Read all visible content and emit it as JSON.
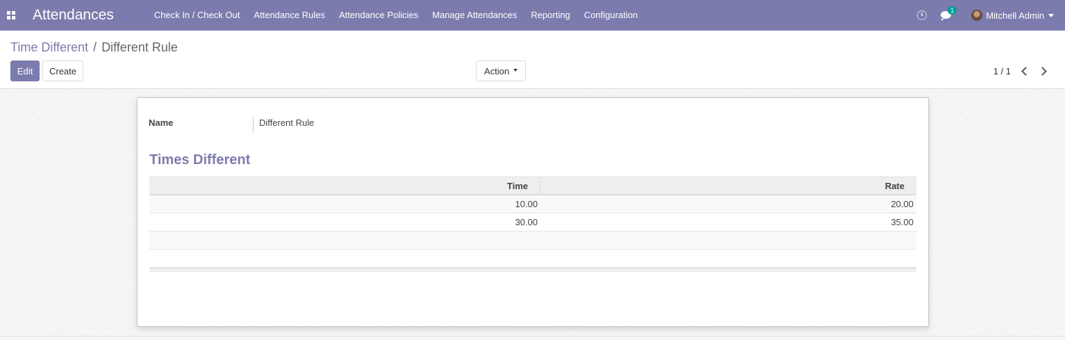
{
  "navbar": {
    "app_name": "Attendances",
    "menu": [
      {
        "label": "Check In / Check Out"
      },
      {
        "label": "Attendance Rules"
      },
      {
        "label": "Attendance Policies"
      },
      {
        "label": "Manage Attendances"
      },
      {
        "label": "Reporting"
      },
      {
        "label": "Configuration"
      }
    ],
    "messages_badge": "1",
    "user_name": "Mitchell Admin",
    "colors": {
      "brand": "#7c7bad",
      "badge": "#00a09d"
    }
  },
  "breadcrumb": {
    "parent": "Time Different",
    "separator": "/",
    "current": "Different Rule"
  },
  "toolbar": {
    "edit_label": "Edit",
    "create_label": "Create",
    "action_label": "Action",
    "pager_value": "1 / 1"
  },
  "form": {
    "name_label": "Name",
    "name_value": "Different Rule",
    "section_title": "Times Different",
    "table": {
      "columns": [
        "Time",
        "Rate"
      ],
      "rows": [
        {
          "time": "10.00",
          "rate": "20.00"
        },
        {
          "time": "30.00",
          "rate": "35.00"
        }
      ]
    }
  }
}
